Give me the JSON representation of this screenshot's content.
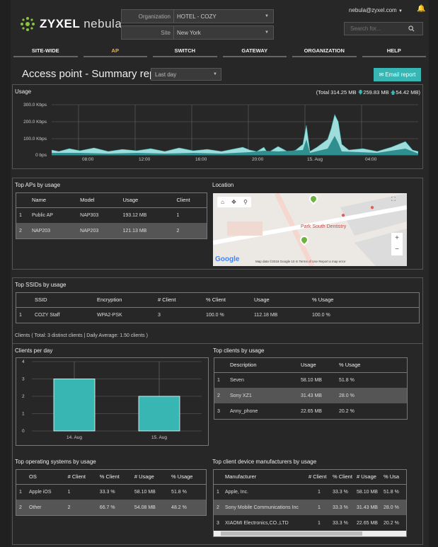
{
  "header": {
    "logo_brand": "ZYXEL",
    "logo_product": "nebula",
    "org_label": "Organization",
    "org_value": "HOTEL - COZY",
    "site_label": "Site",
    "site_value": "New York",
    "user": "nebula@zyxel.com",
    "search_placeholder": "Search for..."
  },
  "nav": [
    "SITE-WIDE",
    "AP",
    "SWITCH",
    "GATEWAY",
    "ORGANIZATION",
    "HELP"
  ],
  "page": {
    "title": "Access point - Summary report",
    "range": "Last day",
    "email_button": "Email report"
  },
  "usage": {
    "title": "Usage",
    "total": "(Total 314.25 MB",
    "down": "259.83 MB",
    "up": "54.42 MB)",
    "ylabels": [
      "300.0 Kbps",
      "200.0 Kbps",
      "100.0 Kbps",
      "0 bps"
    ],
    "xlabels": [
      "08:00",
      "12:00",
      "16:00",
      "20:00",
      "15. Aug",
      "04:00"
    ]
  },
  "top_aps": {
    "title": "Top APs by usage",
    "headers": [
      "Name",
      "Model",
      "Usage",
      "Client"
    ],
    "rows": [
      [
        "1",
        "Public AP",
        "NAP303",
        "193.12 MB",
        "1"
      ],
      [
        "2",
        "NAP203",
        "NAP203",
        "121.13 MB",
        "2"
      ]
    ]
  },
  "location": {
    "title": "Location",
    "poi": "Park South Dentistry",
    "google": "Google",
    "attrib": "Map data ©2018 Google   10 m",
    "terms": "Terms of Use",
    "report": "Report a map error",
    "zoom_in": "+",
    "zoom_out": "−"
  },
  "ssids": {
    "title": "Top SSIDs by usage",
    "headers": [
      "SSID",
      "Encryption",
      "# Client",
      "% Client",
      "Usage",
      "% Usage"
    ],
    "rows": [
      [
        "1",
        "COZY Staff",
        "WPA2-PSK",
        "3",
        "100.0 %",
        "112.18 MB",
        "100.0 %"
      ]
    ]
  },
  "clients_summary": "Clients ( Total: 3 distinct clients | Daily Average: 1.50 clients )",
  "clients_per_day": {
    "title": "Clients per day"
  },
  "chart_data": {
    "type": "bar",
    "categories": [
      "14. Aug",
      "15. Aug"
    ],
    "values": [
      3,
      2
    ],
    "ylim": [
      0,
      4
    ],
    "yticks": [
      "4",
      "3",
      "2",
      "1",
      "0"
    ]
  },
  "top_clients": {
    "title": "Top clients by usage",
    "headers": [
      "Description",
      "Usage",
      "% Usage"
    ],
    "rows": [
      [
        "1",
        "Seven",
        "58.10 MB",
        "51.8 %"
      ],
      [
        "2",
        "Sony XZ1",
        "31.43 MB",
        "28.0 %"
      ],
      [
        "3",
        "Anny_phone",
        "22.65 MB",
        "20.2 %"
      ]
    ]
  },
  "top_os": {
    "title": "Top operating systems by usage",
    "headers": [
      "OS",
      "# Client",
      "% Client",
      "# Usage",
      "% Usage"
    ],
    "rows": [
      [
        "1",
        "Apple iOS",
        "1",
        "33.3 %",
        "58.10 MB",
        "51.8 %"
      ],
      [
        "2",
        "Other",
        "2",
        "66.7 %",
        "54.08 MB",
        "48.2 %"
      ]
    ]
  },
  "top_mfr": {
    "title": "Top client device manufacturers by usage",
    "headers": [
      "Manufacturer",
      "# Client",
      "% Client",
      "# Usage",
      "% Usa"
    ],
    "rows": [
      [
        "1",
        "Apple, Inc.",
        "1",
        "33.3 %",
        "58.10 MB",
        "51.8 %"
      ],
      [
        "2",
        "Sony Mobile Communications Inc",
        "1",
        "33.3 %",
        "31.43 MB",
        "28.0 %"
      ],
      [
        "3",
        "XIAOMI Electronics,CO.,LTD",
        "1",
        "33.3 %",
        "22.65 MB",
        "20.2 %"
      ]
    ]
  },
  "colors": {
    "accent": "#37b6b3",
    "active_nav": "#f2b33d",
    "email_btn": "#37b6b3"
  }
}
